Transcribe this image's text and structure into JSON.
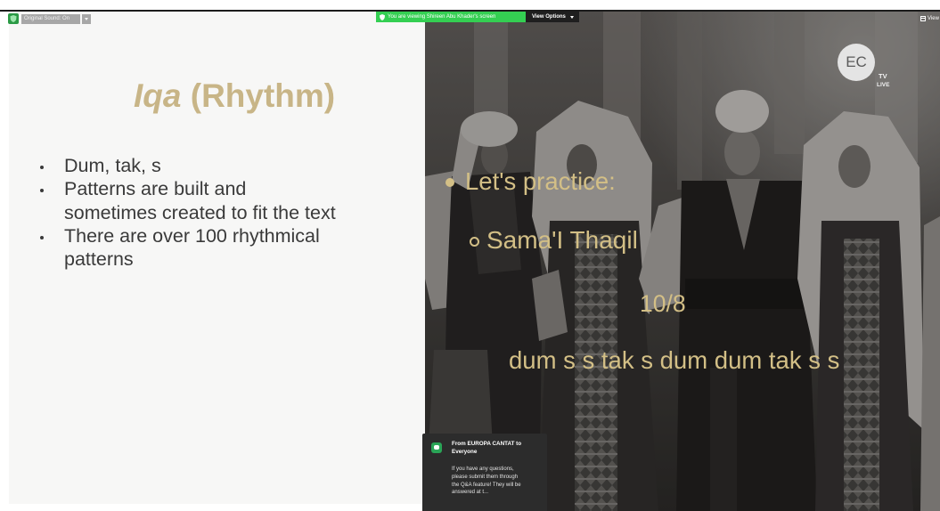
{
  "zoom_toolbar": {
    "encryption_icon": "shield-icon",
    "original_sound_label": "Original Sound: On",
    "original_sound_menu_icon": "chevron-down-icon",
    "viewing_banner_icon": "shield-icon",
    "viewing_banner_text": "You are viewing Shireen Abu Khader's screen",
    "view_options_label": "View Options",
    "view_options_icon": "chevron-down-icon",
    "view_label": "View",
    "view_icon": "layout-icon"
  },
  "left_slide": {
    "title_emphasis": "Iqa",
    "title_rest": "(Rhythm)",
    "bullet_icon": "bullet-dot-icon",
    "bullets": [
      {
        "lines": [
          "Dum, tak, s"
        ]
      },
      {
        "lines": [
          "Patterns are built and",
          "sometimes created to fit the text"
        ]
      },
      {
        "lines": [
          "There are over 100 rhythmical",
          "patterns"
        ]
      }
    ]
  },
  "right_slide": {
    "logo": {
      "mark": "EC",
      "line1": "TV",
      "line2": "LIVE"
    },
    "bullet_icon": "filled-circle-icon",
    "bullet_text": "Let's practice:",
    "sub_bullet_icon": "hollow-circle-icon",
    "sub_bullet_text": "Sama'I Thaqil",
    "time_signature": "10/8",
    "rhythm_pattern": "dum s s tak s dum dum tak s s"
  },
  "chat_notification": {
    "avatar_icon": "chat-icon",
    "sender_lines": [
      "From EUROPA CANTAT to",
      "Everyone"
    ],
    "message_lines": [
      "If you have any questions,",
      "please submit them through",
      "the Q&A feature! They will be",
      "answered at t..."
    ]
  },
  "colors": {
    "slide_title": "#c8b587",
    "body_text": "#3a3a3a",
    "overlay_text": "#d3bf86",
    "banner_green": "#34cf52",
    "chat_background": "#2c2c2c",
    "chat_icon": "#2aa457"
  }
}
